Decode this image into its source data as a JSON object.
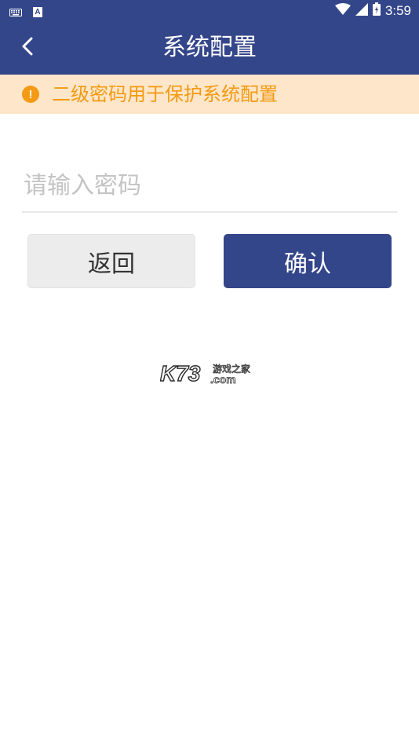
{
  "statusbar": {
    "time": "3:59"
  },
  "appbar": {
    "title": "系统配置"
  },
  "notice": {
    "text": "二级密码用于保护系统配置"
  },
  "password": {
    "placeholder": "请输入密码",
    "value": ""
  },
  "buttons": {
    "back_label": "返回",
    "confirm_label": "确认"
  },
  "watermark": {
    "brand": "K73",
    "suffix": ".com",
    "tagline": "游戏之家"
  },
  "colors": {
    "primary": "#34468a",
    "notice_bg": "#fde6c9",
    "notice_text": "#f39a13",
    "secondary_btn": "#ececec"
  },
  "icons": [
    "keyboard-icon",
    "a-notification-icon",
    "wifi-icon",
    "signal-icon",
    "battery-icon",
    "back-arrow-icon",
    "warning-icon"
  ]
}
